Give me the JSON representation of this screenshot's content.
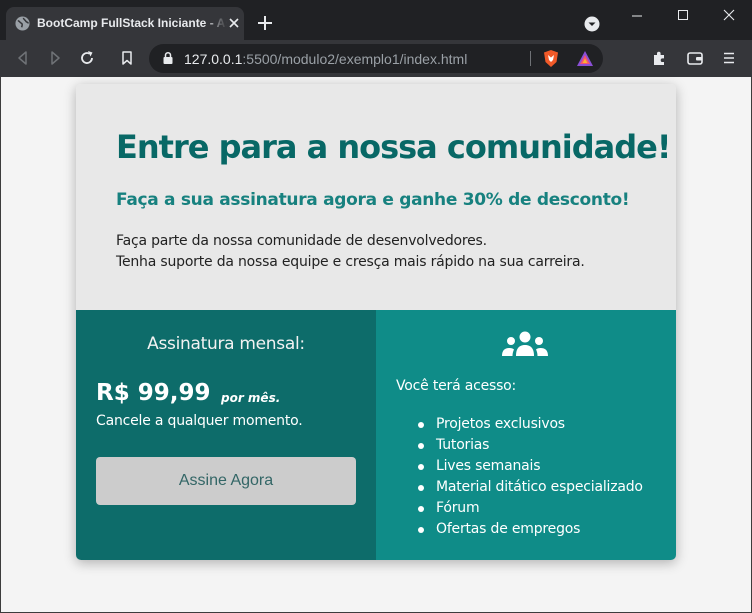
{
  "browser": {
    "tab_title": "BootCamp FullStack Iniciante - Assinatura",
    "url_host": "127.0.0.1",
    "url_rest": ":5500/modulo2/exemplo1/index.html"
  },
  "hero": {
    "headline": "Entre para a nossa comunidade!",
    "subheadline": "Faça a sua assinatura agora e ganhe 30% de desconto!",
    "description_lines": [
      "Faça parte da nossa comunidade de desenvolvedores.",
      "Tenha suporte da nossa equipe e cresça mais rápido na sua carreira."
    ]
  },
  "plan": {
    "title": "Assinatura mensal:",
    "price": "R$ 99,99",
    "period": "por mês.",
    "cancel_note": "Cancele a qualquer momento.",
    "button_label": "Assine Agora"
  },
  "benefits": {
    "icon": "users-icon",
    "label": "Você terá acesso:",
    "items": [
      "Projetos exclusivos",
      "Tutorias",
      "Lives semanais",
      "Material ditático especializado",
      "Fórum",
      "Ofertas de empregos"
    ]
  },
  "colors": {
    "chrome_dark": "#202124",
    "chrome_mid": "#35363a",
    "card_top": "#e8e8e8",
    "teal_dark": "#0d6c6a",
    "teal": "#0f8c88",
    "headline": "#086866",
    "button": "#cccccc"
  }
}
